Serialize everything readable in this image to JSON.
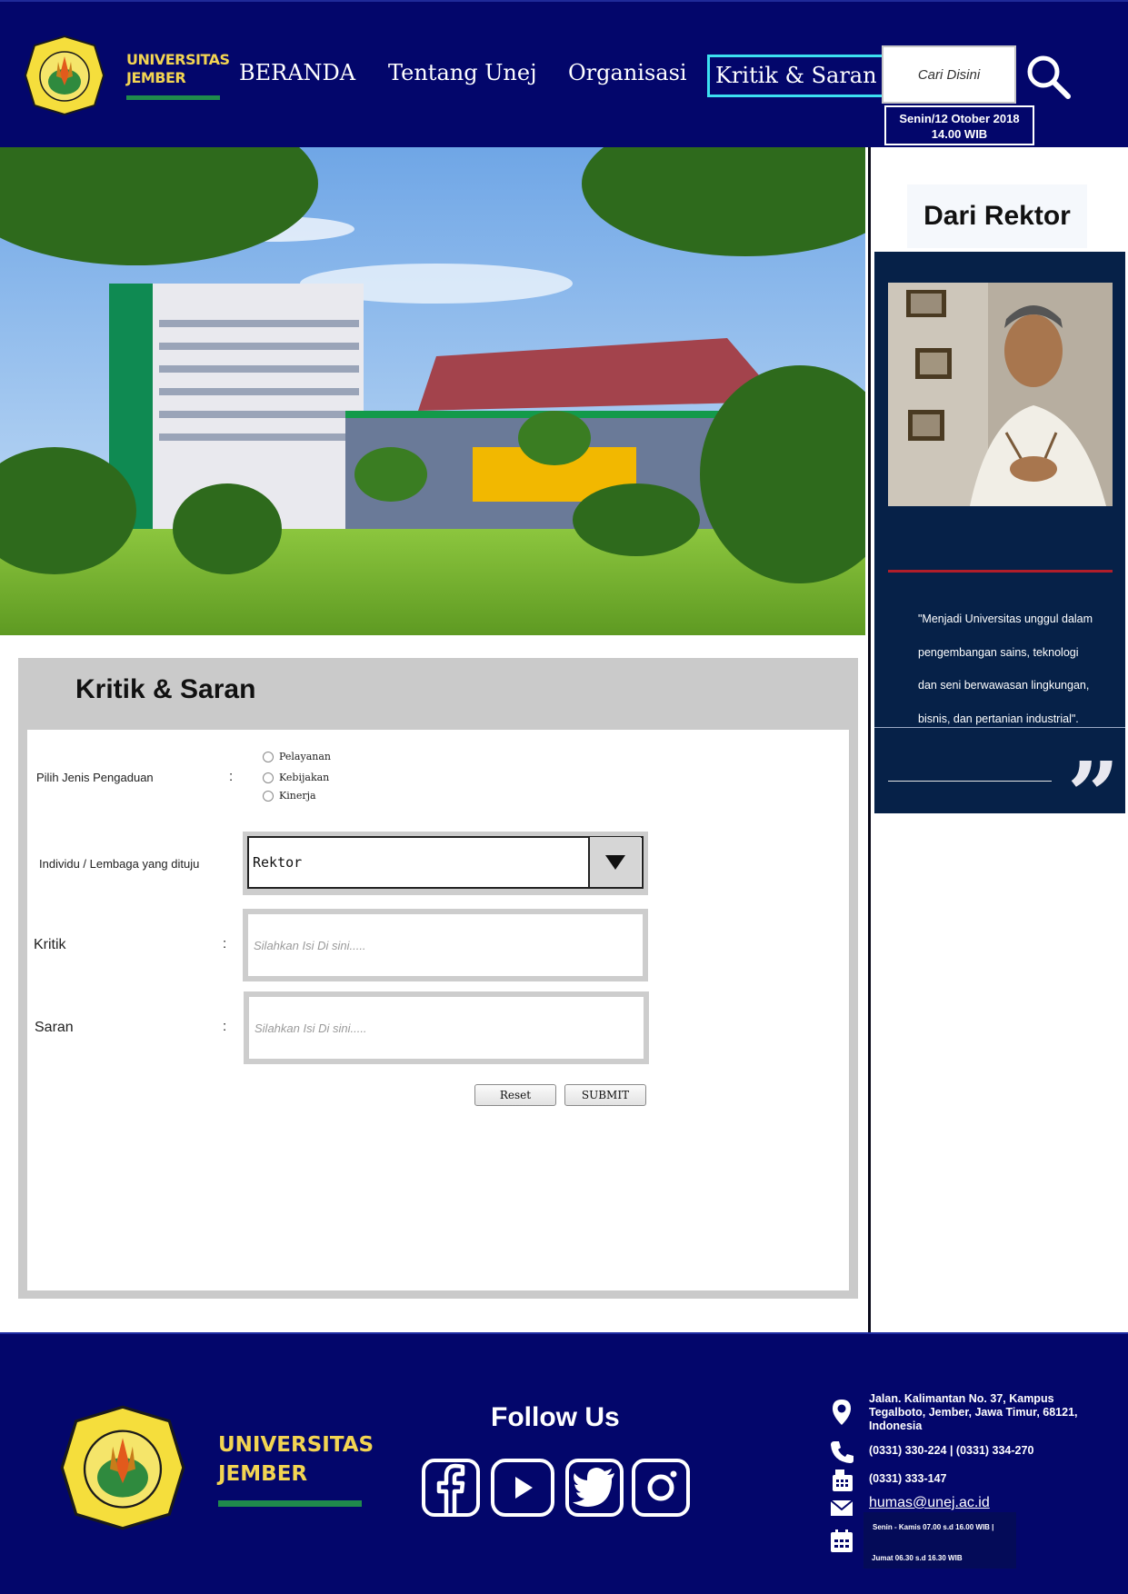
{
  "header": {
    "brand_line1": "UNIVERSITAS",
    "brand_line2": "JEMBER",
    "nav": [
      "BERANDA",
      "Tentang Unej",
      "Organisasi",
      "Kritik & Saran"
    ],
    "active_nav_index": 3,
    "search_placeholder": "Cari Disini",
    "date": "Senin/12 Otober 2018",
    "time": "14.00 WIB"
  },
  "sidebar": {
    "title": "Dari Rektor",
    "quote": "\"Menjadi Universitas unggul dalam pengembangan sains, teknologi dan seni berwawasan lingkungan, bisnis, dan pertanian industrial\".",
    "quote_mark": "”"
  },
  "form": {
    "title": "Kritik & Saran",
    "type_label": "Pilih Jenis Pengaduan",
    "colon": ":",
    "type_options": [
      "Pelayanan",
      "Kebijakan",
      "Kinerja"
    ],
    "target_label": "Individu / Lembaga yang dituju",
    "target_value": "Rektor",
    "kritik_label": "Kritik",
    "saran_label": "Saran",
    "kritik_placeholder": "Silahkan Isi Di sini.....",
    "saran_placeholder": "Silahkan Isi Di sini.....",
    "reset_label": "Reset",
    "submit_label": "SUBMIT"
  },
  "footer": {
    "brand_line1": "UNIVERSITAS",
    "brand_line2": "JEMBER",
    "follow_title": "Follow Us",
    "socials": [
      "facebook-icon",
      "youtube-icon",
      "twitter-icon",
      "instagram-icon"
    ],
    "address": "Jalan. Kalimantan No. 37, Kampus Tegalboto, Jember, Jawa Timur, 68121, Indonesia",
    "phone": "(0331) 330-224 | (0331) 334-270",
    "fax": "(0331) 333-147",
    "email": "humas@unej.ac.id",
    "hours_line1": "Senin - Kamis 07.00 s.d 16.00 WIB |",
    "hours_line2": "Jumat 06.30 s.d 16.30 WIB"
  },
  "colors": {
    "navy": "#03066b",
    "gold": "#f2d452",
    "green": "#1f8a4c",
    "active_border": "#3ce0f0",
    "card": "#062148",
    "panel_gray": "#cacaca"
  }
}
